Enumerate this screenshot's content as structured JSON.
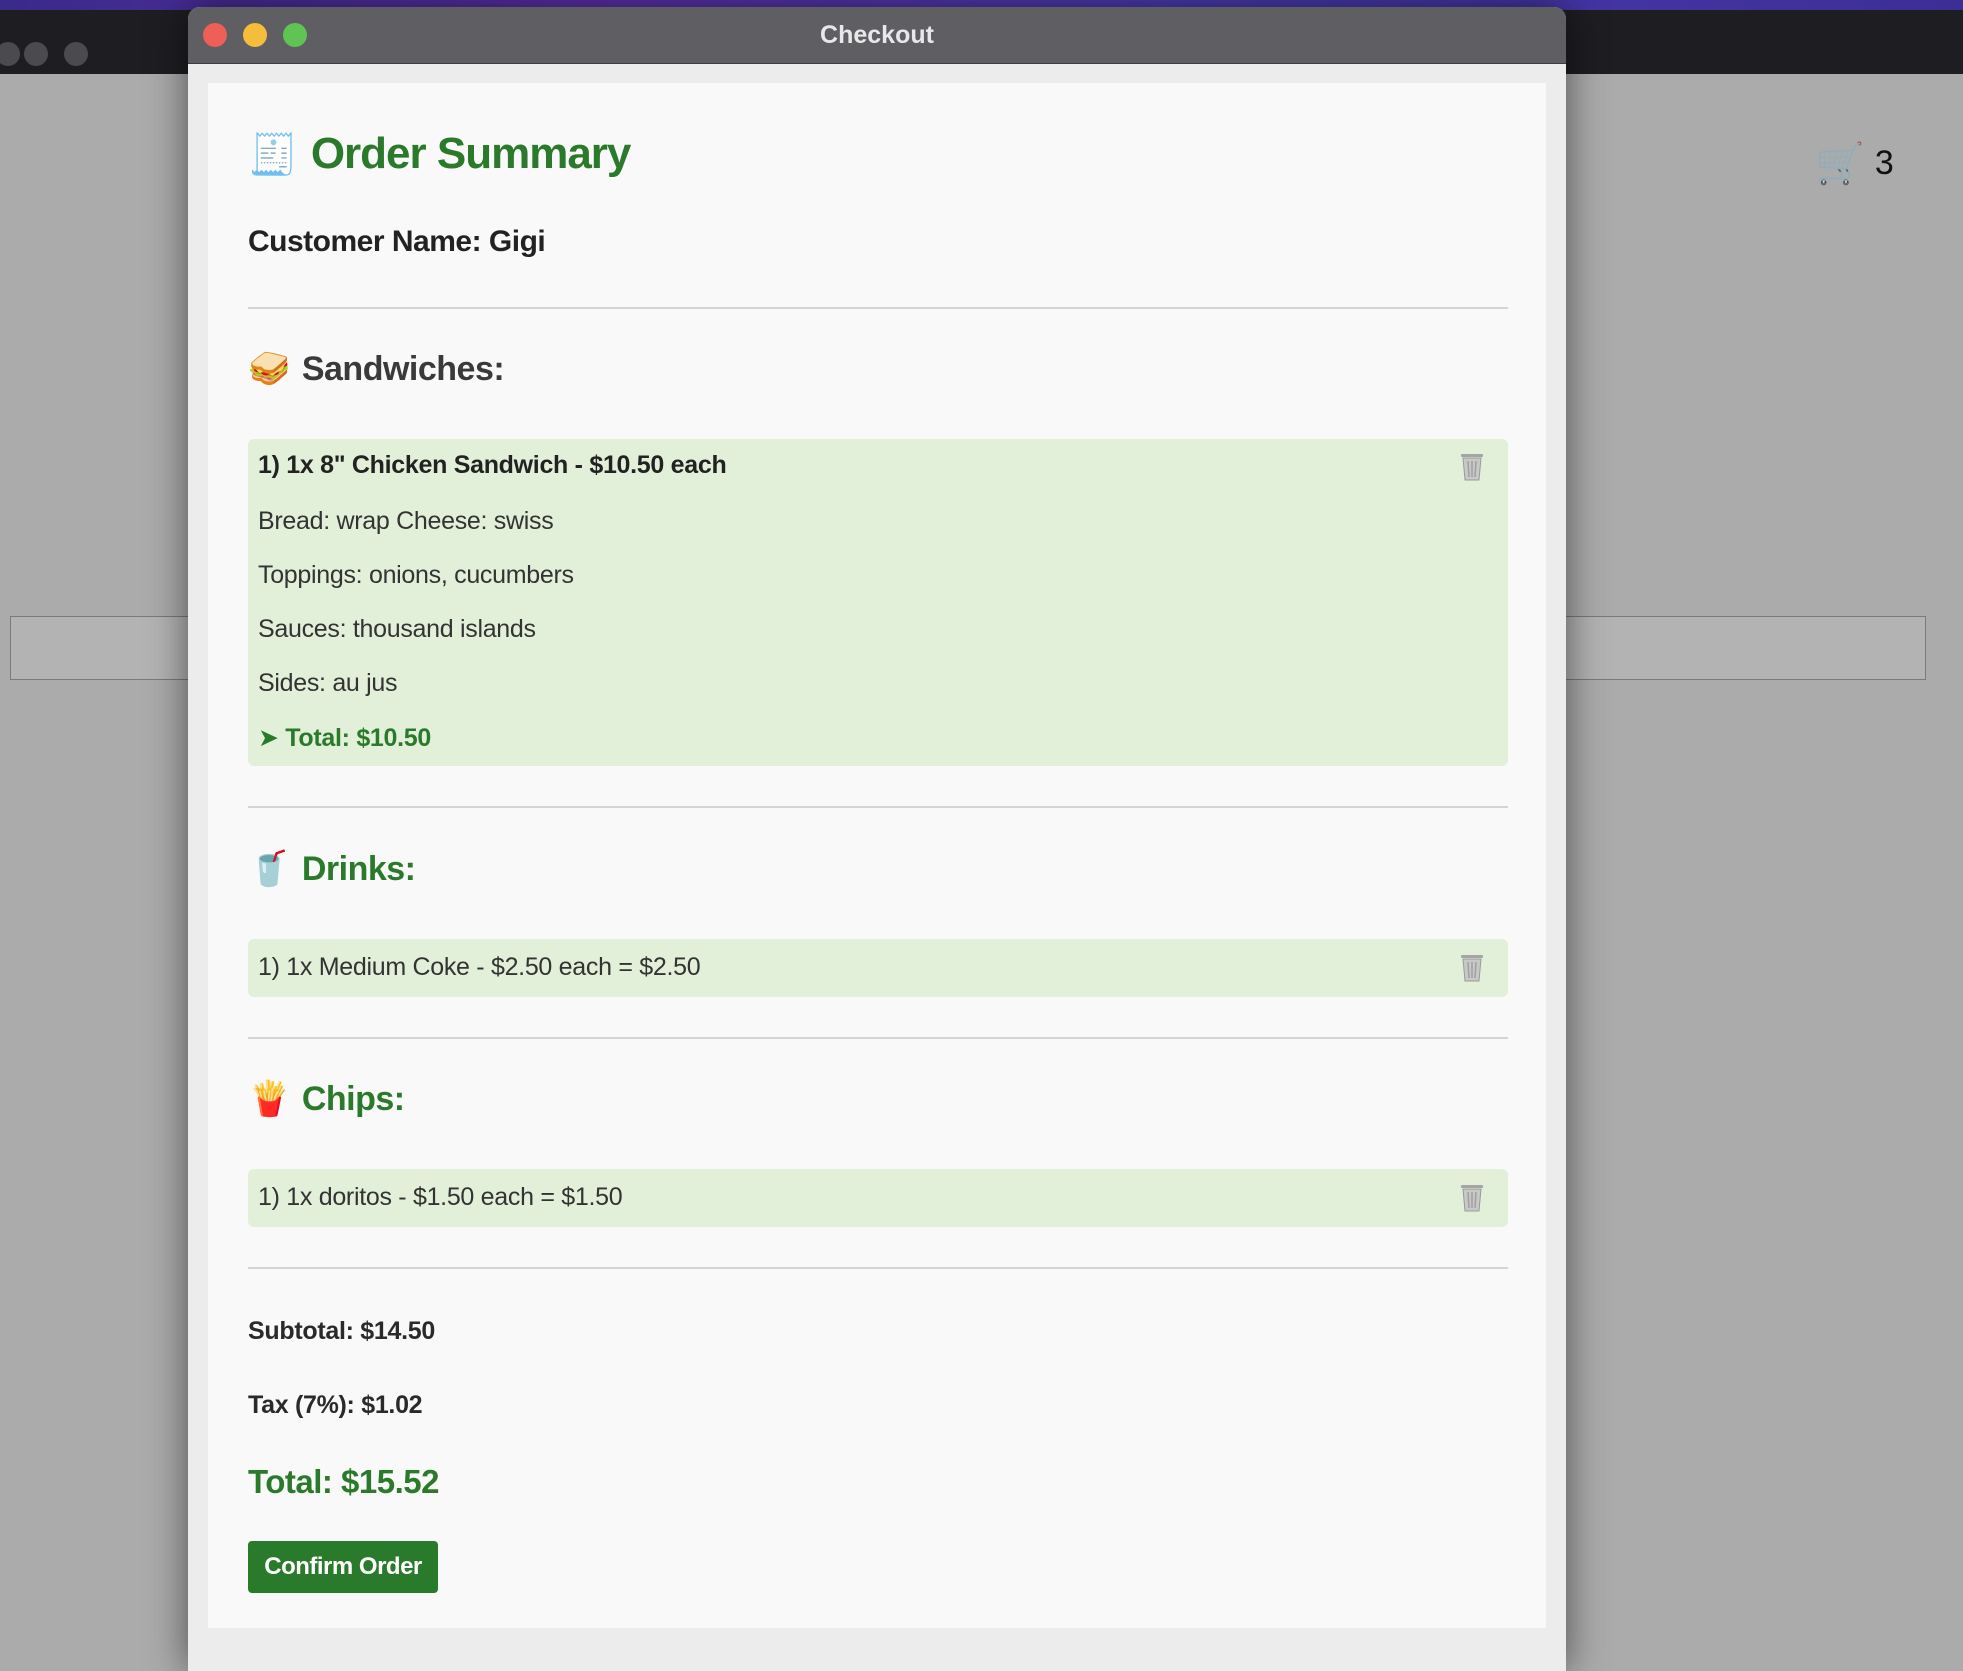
{
  "window": {
    "title": "Checkout"
  },
  "background": {
    "cart_count": "3",
    "cart_icon": "shopping-cart-icon"
  },
  "order": {
    "heading": "Order Summary",
    "heading_icon": "receipt-icon",
    "customer_label": "Customer Name: Gigi"
  },
  "sections": {
    "sandwiches": {
      "title": "Sandwiches:",
      "icon": "sandwich-icon",
      "items": [
        {
          "header": "1) 1x 8\" Chicken Sandwich  - $10.50 each",
          "bread_cheese": "Bread: wrap    Cheese: swiss",
          "toppings": "Toppings: onions, cucumbers",
          "sauces": "Sauces: thousand islands",
          "sides": "Sides: au jus",
          "total": "➤ Total: $10.50"
        }
      ]
    },
    "drinks": {
      "title": "Drinks:",
      "icon": "drink-cup-icon",
      "items": [
        {
          "text": "1) 1x Medium Coke - $2.50 each = $2.50"
        }
      ]
    },
    "chips": {
      "title": "Chips:",
      "icon": "fries-icon",
      "items": [
        {
          "text": "1) 1x doritos - $1.50 each = $1.50"
        }
      ]
    }
  },
  "totals": {
    "subtotal": "Subtotal: $14.50",
    "tax": "Tax (7%): $1.02",
    "total": "Total: $15.52"
  },
  "actions": {
    "confirm_label": "Confirm Order"
  },
  "colors": {
    "accent_green": "#2b7a2b",
    "card_bg": "#e2f0d9",
    "button_bg": "#2a7a2c"
  }
}
